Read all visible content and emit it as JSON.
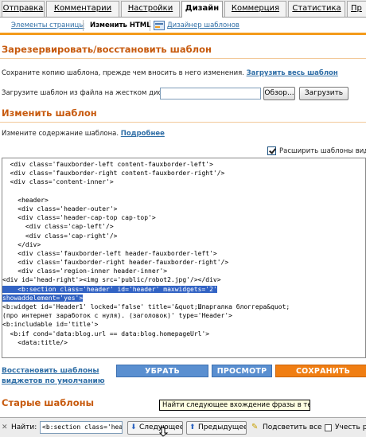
{
  "tabs": [
    "Отправка",
    "Комментарии",
    "Настройки",
    "Дизайн",
    "Коммерция",
    "Статистика",
    "Пр"
  ],
  "subtabs": [
    "Элементы страницы",
    "Изменить HTML",
    "Дизайнер шаблонов"
  ],
  "backup": {
    "heading": "Зарезервировать/восстановить шаблон",
    "save_text": "Сохраните копию шаблона, прежде чем вносить в него изменения.",
    "download_link": "Загрузить весь шаблон",
    "upload_text": "Загрузите шаблон из файла на жестком диске:",
    "browse_button": "Обзор...",
    "upload_button": "Загрузить"
  },
  "edit": {
    "heading": "Изменить шаблон",
    "description": "Измените содержание шаблона.",
    "more_link": "Подробнее",
    "expand_label": "Расширить шаблоны видж"
  },
  "code_lines": [
    "  <div class='fauxborder-left content-fauxborder-left'>",
    "  <div class='fauxborder-right content-fauxborder-right'/>",
    "  <div class='content-inner'>",
    "",
    "    <header>",
    "    <div class='header-outer'>",
    "    <div class='header-cap-top cap-top'>",
    "      <div class='cap-left'/>",
    "      <div class='cap-right'/>",
    "    </div>",
    "    <div class='fauxborder-left header-fauxborder-left'>",
    "    <div class='fauxborder-right header-fauxborder-right'/>",
    "    <div class='region-inner header-inner'>",
    "<div id='head-right'><img src='public/robot2.jpg'/></div>",
    "    <b:section class='header' id='header' maxwidgets='2'",
    "showaddelement='yes'>",
    "<b:widget id='Header1' locked='false' title='&quot;Шпаргалка блоггера&quot;",
    "(про интернет заработок с нуля). (заголовок)' type='Header'>",
    "<b:includable id='title'>",
    "  <b:if cond='data:blog.url == data:blog.homepageUrl'>",
    "    <data:title/>"
  ],
  "revert_link_line1": "Восстановить шаблоны",
  "revert_link_line2": "виджетов по умолчанию",
  "buttons": {
    "clear": "УБРАТЬ ИЗМЕНЕНИЯ",
    "preview": "ПРОСМОТР",
    "save": "СОХРАНИТЬ ШАБЛОН"
  },
  "old_templates_heading": "Старые шаблоны",
  "findbar": {
    "label": "Найти:",
    "value": "<b:section class='header",
    "next": "Следующее",
    "prev": "Предыдущее",
    "highlight": "Подсветить все",
    "case": "Учесть р"
  },
  "tooltip": "Найти следующее вхождение фразы в текст"
}
